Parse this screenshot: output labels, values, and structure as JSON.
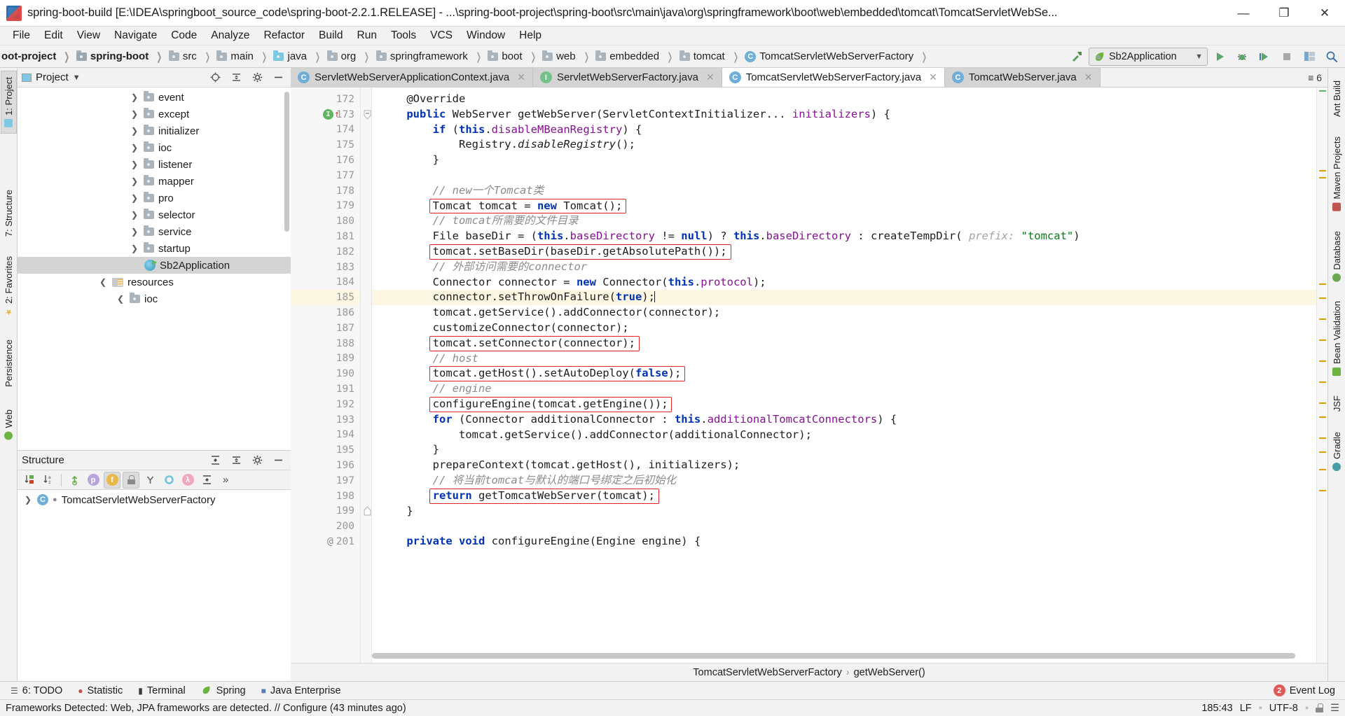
{
  "window": {
    "title": "spring-boot-build [E:\\IDEA\\springboot_source_code\\spring-boot-2.2.1.RELEASE] - ...\\spring-boot-project\\spring-boot\\src\\main\\java\\org\\springframework\\boot\\web\\embedded\\tomcat\\TomcatServletWebSe...",
    "minimize": "—",
    "maximize": "❐",
    "close": "✕"
  },
  "menu": [
    "File",
    "Edit",
    "View",
    "Navigate",
    "Code",
    "Analyze",
    "Refactor",
    "Build",
    "Run",
    "Tools",
    "VCS",
    "Window",
    "Help"
  ],
  "breadcrumb": [
    {
      "label": "oot-project",
      "icon": "folder-module",
      "bold": true
    },
    {
      "label": "spring-boot",
      "icon": "folder-module-blue",
      "bold": true
    },
    {
      "label": "src",
      "icon": "folder",
      "bold": false
    },
    {
      "label": "main",
      "icon": "folder",
      "bold": false
    },
    {
      "label": "java",
      "icon": "folder-source-blue",
      "bold": false
    },
    {
      "label": "org",
      "icon": "folder-package",
      "bold": false
    },
    {
      "label": "springframework",
      "icon": "folder-package",
      "bold": false
    },
    {
      "label": "boot",
      "icon": "folder-package",
      "bold": false
    },
    {
      "label": "web",
      "icon": "folder-package",
      "bold": false
    },
    {
      "label": "embedded",
      "icon": "folder-package",
      "bold": false
    },
    {
      "label": "tomcat",
      "icon": "folder-package",
      "bold": false
    },
    {
      "label": "TomcatServletWebServerFactory",
      "icon": "class",
      "bold": false
    }
  ],
  "toolbar": {
    "build_hammer": "build-icon",
    "run_config": "Sb2Application",
    "run": "run-icon",
    "debug": "debug-icon",
    "coverage": "coverage-icon",
    "stop": "stop-icon",
    "layout": "layout-icon",
    "search": "search-icon"
  },
  "project_panel": {
    "title": "Project",
    "dropdown": "▾",
    "locate_icon": "locate-icon",
    "collapse_icon": "collapse-all-icon",
    "settings_icon": "gear-icon",
    "hide_icon": "hide-icon",
    "tree": [
      {
        "label": "event",
        "icon": "folder",
        "indent": 5,
        "expandable": true,
        "selected": false
      },
      {
        "label": "except",
        "icon": "folder",
        "indent": 5,
        "expandable": true,
        "selected": false
      },
      {
        "label": "initializer",
        "icon": "folder",
        "indent": 5,
        "expandable": true,
        "selected": false
      },
      {
        "label": "ioc",
        "icon": "folder",
        "indent": 5,
        "expandable": true,
        "selected": false
      },
      {
        "label": "listener",
        "icon": "folder",
        "indent": 5,
        "expandable": true,
        "selected": false
      },
      {
        "label": "mapper",
        "icon": "folder",
        "indent": 5,
        "expandable": true,
        "selected": false
      },
      {
        "label": "pro",
        "icon": "folder",
        "indent": 5,
        "expandable": true,
        "selected": false
      },
      {
        "label": "selector",
        "icon": "folder",
        "indent": 5,
        "expandable": true,
        "selected": false
      },
      {
        "label": "service",
        "icon": "folder",
        "indent": 5,
        "expandable": true,
        "selected": false
      },
      {
        "label": "startup",
        "icon": "folder",
        "indent": 5,
        "expandable": true,
        "selected": false
      },
      {
        "label": "Sb2Application",
        "icon": "spring-class",
        "indent": 6,
        "expandable": false,
        "selected": true
      },
      {
        "label": "resources",
        "icon": "resource-folder",
        "indent": 4,
        "expandable": true,
        "expanded": true,
        "selected": false
      },
      {
        "label": "ioc",
        "icon": "folder",
        "indent": 5,
        "expandable": true,
        "expanded": true,
        "selected": false
      }
    ]
  },
  "structure_panel": {
    "title": "Structure",
    "expand_icon": "expand-all-icon",
    "collapse_icon": "collapse-all-icon",
    "settings_icon": "gear-icon",
    "hide_icon": "hide-icon",
    "tools": [
      {
        "name": "sort-by-visibility-icon",
        "active": false
      },
      {
        "name": "sort-alphabetically-icon",
        "active": false
      },
      {
        "name": "show-inherited-icon",
        "active": false
      },
      {
        "name": "show-properties-icon",
        "active": false,
        "glyph": "p",
        "color": "#b9a3db"
      },
      {
        "name": "show-fields-icon",
        "active": true,
        "glyph": "f",
        "color": "#e8b84b"
      },
      {
        "name": "show-non-public-icon",
        "active": true,
        "glyph": "■",
        "color": "#e08b52"
      },
      {
        "name": "show-anonymous-icon",
        "active": false
      },
      {
        "name": "show-interfaces-icon",
        "active": false,
        "color": "#6ec5dd"
      },
      {
        "name": "show-lambdas-icon",
        "active": false,
        "glyph": "λ",
        "color": "#f0a8bc"
      },
      {
        "name": "expand-all-icon",
        "active": false
      },
      {
        "name": "more-icon",
        "active": false,
        "glyph": "»"
      }
    ],
    "items": [
      {
        "label": "TomcatServletWebServerFactory",
        "icon": "class",
        "expandable": true
      }
    ]
  },
  "editor": {
    "tabs": [
      {
        "label": "ServletWebServerApplicationContext.java",
        "icon": "class",
        "active": false,
        "closable": true
      },
      {
        "label": "ServletWebServerFactory.java",
        "icon": "interface",
        "active": false,
        "closable": true
      },
      {
        "label": "TomcatServletWebServerFactory.java",
        "icon": "class",
        "active": true,
        "closable": true
      },
      {
        "label": "TomcatWebServer.java",
        "icon": "class",
        "active": false,
        "closable": true
      }
    ],
    "tab_overflow": "≡ 6",
    "first_line": 172,
    "current_line": 185,
    "lines": [
      {
        "n": 172,
        "tokens": [
          {
            "t": "    ",
            "c": ""
          },
          {
            "t": "@Override",
            "c": "an"
          }
        ]
      },
      {
        "n": 173,
        "marker": "run",
        "tokens": [
          {
            "t": "    ",
            "c": ""
          },
          {
            "t": "public",
            "c": "kw"
          },
          {
            "t": " WebServer getWebServer(ServletContextInitializer... ",
            "c": ""
          },
          {
            "t": "initializers",
            "c": "fld"
          },
          {
            "t": ") {",
            "c": ""
          }
        ]
      },
      {
        "n": 174,
        "tokens": [
          {
            "t": "        ",
            "c": ""
          },
          {
            "t": "if",
            "c": "kw"
          },
          {
            "t": " (",
            "c": ""
          },
          {
            "t": "this",
            "c": "kw"
          },
          {
            "t": ".",
            "c": ""
          },
          {
            "t": "disableMBeanRegistry",
            "c": "fld"
          },
          {
            "t": ") {",
            "c": ""
          }
        ]
      },
      {
        "n": 175,
        "tokens": [
          {
            "t": "            Registry.",
            "c": ""
          },
          {
            "t": "disableRegistry",
            "c": "st"
          },
          {
            "t": "();",
            "c": ""
          }
        ]
      },
      {
        "n": 176,
        "tokens": [
          {
            "t": "        }",
            "c": ""
          }
        ]
      },
      {
        "n": 177,
        "tokens": [
          {
            "t": "",
            "c": ""
          }
        ]
      },
      {
        "n": 178,
        "tokens": [
          {
            "t": "        ",
            "c": ""
          },
          {
            "t": "// new一个Tomcat类",
            "c": "cm"
          }
        ]
      },
      {
        "n": 179,
        "box": true,
        "tokens": [
          {
            "t": "        Tomcat tomcat = ",
            "c": ""
          },
          {
            "t": "new",
            "c": "kw"
          },
          {
            "t": " Tomcat();",
            "c": ""
          }
        ]
      },
      {
        "n": 180,
        "tokens": [
          {
            "t": "        ",
            "c": ""
          },
          {
            "t": "// tomcat所需要的文件目录",
            "c": "cm"
          }
        ]
      },
      {
        "n": 181,
        "tokens": [
          {
            "t": "        File baseDir = (",
            "c": ""
          },
          {
            "t": "this",
            "c": "kw"
          },
          {
            "t": ".",
            "c": ""
          },
          {
            "t": "baseDirectory",
            "c": "fld"
          },
          {
            "t": " != ",
            "c": ""
          },
          {
            "t": "null",
            "c": "kw"
          },
          {
            "t": ") ? ",
            "c": ""
          },
          {
            "t": "this",
            "c": "kw"
          },
          {
            "t": ".",
            "c": ""
          },
          {
            "t": "baseDirectory",
            "c": "fld"
          },
          {
            "t": " : createTempDir( ",
            "c": ""
          },
          {
            "t": "prefix:",
            "c": "par"
          },
          {
            "t": " ",
            "c": ""
          },
          {
            "t": "\"tomcat\"",
            "c": "str"
          },
          {
            "t": ")",
            "c": ""
          }
        ]
      },
      {
        "n": 182,
        "box": true,
        "tokens": [
          {
            "t": "        tomcat.setBaseDir(baseDir.getAbsolutePath());",
            "c": ""
          }
        ]
      },
      {
        "n": 183,
        "tokens": [
          {
            "t": "        ",
            "c": ""
          },
          {
            "t": "// 外部访问需要的connector",
            "c": "cm"
          }
        ]
      },
      {
        "n": 184,
        "tokens": [
          {
            "t": "        Connector connector = ",
            "c": ""
          },
          {
            "t": "new",
            "c": "kw"
          },
          {
            "t": " Connector(",
            "c": ""
          },
          {
            "t": "this",
            "c": "kw"
          },
          {
            "t": ".",
            "c": ""
          },
          {
            "t": "protocol",
            "c": "fld"
          },
          {
            "t": ");",
            "c": ""
          }
        ]
      },
      {
        "n": 185,
        "current": true,
        "caret": true,
        "tokens": [
          {
            "t": "        connector.setThrowOnFailure(",
            "c": ""
          },
          {
            "t": "true",
            "c": "kw"
          },
          {
            "t": ");",
            "c": ""
          }
        ]
      },
      {
        "n": 186,
        "tokens": [
          {
            "t": "        tomcat.getService().addConnector(connector);",
            "c": ""
          }
        ]
      },
      {
        "n": 187,
        "tokens": [
          {
            "t": "        customizeConnector(connector);",
            "c": ""
          }
        ]
      },
      {
        "n": 188,
        "box": true,
        "tokens": [
          {
            "t": "        tomcat.setConnector(connector);",
            "c": ""
          }
        ]
      },
      {
        "n": 189,
        "tokens": [
          {
            "t": "        ",
            "c": ""
          },
          {
            "t": "// host",
            "c": "cm"
          }
        ]
      },
      {
        "n": 190,
        "box": true,
        "tokens": [
          {
            "t": "        tomcat.getHost().setAutoDeploy(",
            "c": ""
          },
          {
            "t": "false",
            "c": "kw"
          },
          {
            "t": ");",
            "c": ""
          }
        ]
      },
      {
        "n": 191,
        "tokens": [
          {
            "t": "        ",
            "c": ""
          },
          {
            "t": "// engine",
            "c": "cm"
          }
        ]
      },
      {
        "n": 192,
        "box": true,
        "tokens": [
          {
            "t": "        configureEngine(tomcat.getEngine());",
            "c": ""
          }
        ]
      },
      {
        "n": 193,
        "tokens": [
          {
            "t": "        ",
            "c": ""
          },
          {
            "t": "for",
            "c": "kw"
          },
          {
            "t": " (Connector additionalConnector : ",
            "c": ""
          },
          {
            "t": "this",
            "c": "kw"
          },
          {
            "t": ".",
            "c": ""
          },
          {
            "t": "additionalTomcatConnectors",
            "c": "fld"
          },
          {
            "t": ") {",
            "c": ""
          }
        ]
      },
      {
        "n": 194,
        "tokens": [
          {
            "t": "            tomcat.getService().addConnector(additionalConnector);",
            "c": ""
          }
        ]
      },
      {
        "n": 195,
        "tokens": [
          {
            "t": "        }",
            "c": ""
          }
        ]
      },
      {
        "n": 196,
        "tokens": [
          {
            "t": "        prepareContext(tomcat.getHost(), initializers);",
            "c": ""
          }
        ]
      },
      {
        "n": 197,
        "tokens": [
          {
            "t": "        ",
            "c": ""
          },
          {
            "t": "// 将当前tomcat与默认的端口号绑定之后初始化",
            "c": "cm"
          }
        ]
      },
      {
        "n": 198,
        "box": true,
        "tokens": [
          {
            "t": "        ",
            "c": ""
          },
          {
            "t": "return",
            "c": "kw"
          },
          {
            "t": " getTomcatWebServer(tomcat);",
            "c": ""
          }
        ]
      },
      {
        "n": 199,
        "tokens": [
          {
            "t": "    }",
            "c": ""
          }
        ]
      },
      {
        "n": 200,
        "tokens": [
          {
            "t": "",
            "c": ""
          }
        ]
      },
      {
        "n": 201,
        "marker": "at",
        "tokens": [
          {
            "t": "    ",
            "c": ""
          },
          {
            "t": "private",
            "c": "kw"
          },
          {
            "t": " ",
            "c": ""
          },
          {
            "t": "void",
            "c": "kw"
          },
          {
            "t": " configureEngine(Engine engine) {",
            "c": ""
          }
        ]
      }
    ],
    "breadcrumb_bottom": [
      "TomcatServletWebServerFactory",
      "getWebServer()"
    ]
  },
  "left_rail": [
    {
      "label": "1: Project",
      "active": true
    },
    {
      "label": "7: Structure",
      "active": false
    },
    {
      "label": "2: Favorites",
      "active": false
    },
    {
      "label": "Persistence",
      "active": false
    },
    {
      "label": "Web",
      "active": false
    }
  ],
  "right_rail": [
    {
      "label": "Ant Build"
    },
    {
      "label": "Maven Projects"
    },
    {
      "label": "Database"
    },
    {
      "label": "Bean Validation"
    },
    {
      "label": "JSF"
    },
    {
      "label": "Gradle"
    }
  ],
  "bottom_bar": {
    "tabs": [
      {
        "label": "6: TODO",
        "icon": "todo-icon"
      },
      {
        "label": "Statistic",
        "icon": "statistic-icon"
      },
      {
        "label": "Terminal",
        "icon": "terminal-icon"
      },
      {
        "label": "Spring",
        "icon": "spring-icon"
      },
      {
        "label": "Java Enterprise",
        "icon": "java-enterprise-icon"
      }
    ],
    "event_log": {
      "label": "Event Log",
      "count": "2"
    }
  },
  "status_bar": {
    "message": "Frameworks Detected: Web, JPA frameworks are detected. // Configure (43 minutes ago)",
    "position": "185:43",
    "line_separator": "LF",
    "encoding": "UTF-8",
    "lock_icon": "lock-icon",
    "hide_icon": "hide-icon"
  }
}
